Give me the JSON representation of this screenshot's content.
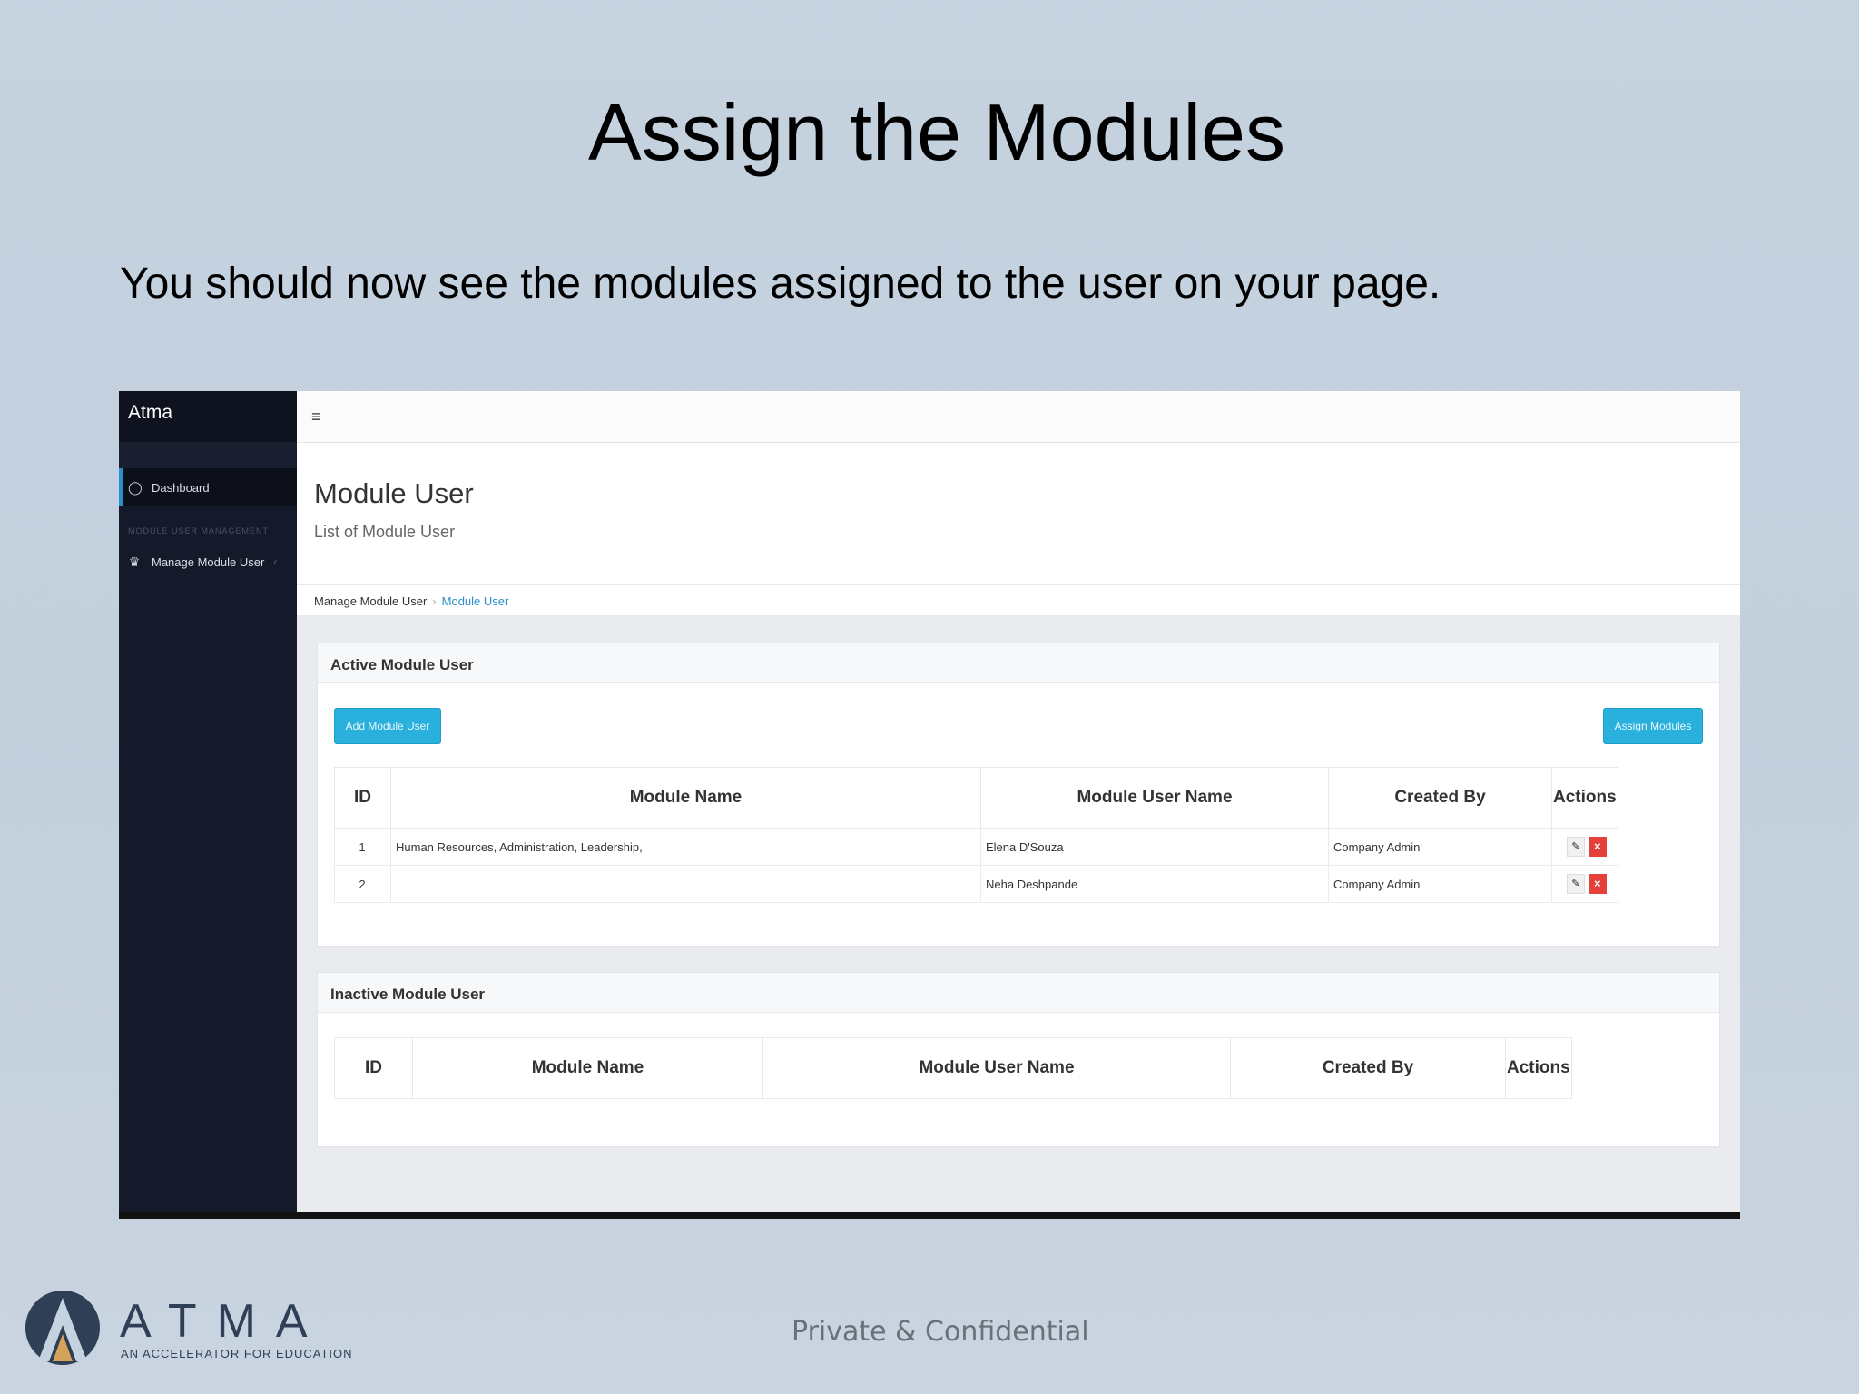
{
  "slide": {
    "title": "Assign the Modules",
    "subtitle": "You should now see the modules assigned to the user on your page.",
    "footer": "Private & Confidential",
    "logo_text": "ATMA",
    "logo_tagline": "AN ACCELERATOR FOR EDUCATION"
  },
  "app": {
    "brand": "Atma",
    "menu_icon": "hamburger-icon",
    "sidebar": {
      "items": [
        {
          "label": "Dashboard",
          "icon": "dashboard-icon"
        }
      ],
      "section_header": "MODULE USER MANAGEMENT",
      "sub_items": [
        {
          "label": "Manage Module User",
          "icon": "users-icon"
        }
      ]
    },
    "page_title": "Module User",
    "page_subtitle": "List of Module User",
    "breadcrumb": [
      "Manage Module User",
      "Module User"
    ],
    "active_panel": {
      "title": "Active Module User",
      "add_button": "Add Module User",
      "assign_button": "Assign Modules",
      "columns": [
        "ID",
        "Module Name",
        "Module User Name",
        "Created By",
        "Actions"
      ],
      "rows": [
        {
          "id": "1",
          "module_name": "Human Resources, Administration, Leadership,",
          "user_name": "Elena D'Souza",
          "created_by": "Company Admin"
        },
        {
          "id": "2",
          "module_name": "",
          "user_name": "Neha Deshpande",
          "created_by": "Company Admin"
        }
      ]
    },
    "inactive_panel": {
      "title": "Inactive Module User",
      "columns": [
        "ID",
        "Module Name",
        "Module User Name",
        "Created By",
        "Actions"
      ]
    },
    "colors": {
      "sidebar": "#151a2b",
      "accent": "#29b0dc",
      "delete": "#e5413a"
    }
  }
}
